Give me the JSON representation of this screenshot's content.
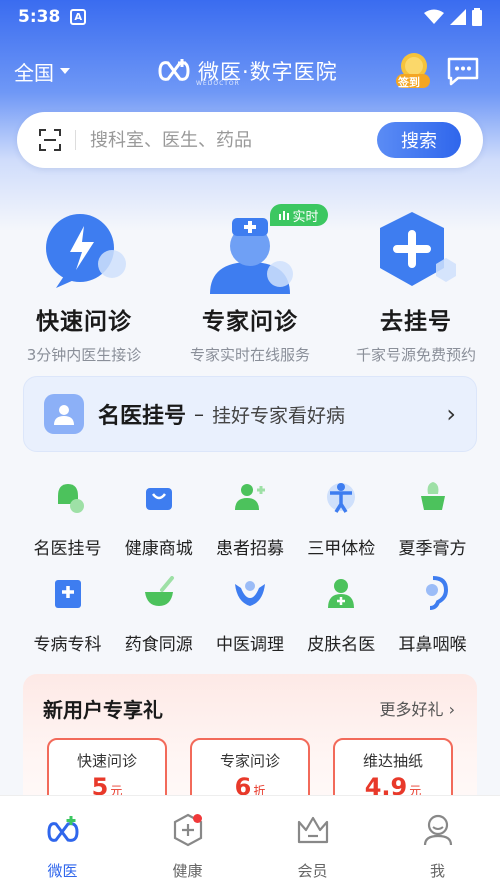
{
  "status": {
    "time": "5:38",
    "a_icon": "A"
  },
  "header": {
    "region": "全国",
    "brand_name": "微医·数字医院",
    "brand_sub": "WEDOCTOR",
    "checkin": "签到"
  },
  "search": {
    "placeholder": "搜科室、医生、药品",
    "button": "搜索"
  },
  "big_cards": [
    {
      "title": "快速问诊",
      "sub": "3分钟内医生接诊",
      "icon": "lightning-bubble-icon"
    },
    {
      "title": "专家问诊",
      "sub": "专家实时在线服务",
      "icon": "doctor-avatar-icon",
      "badge": "实时"
    },
    {
      "title": "去挂号",
      "sub": "千家号源免费预约",
      "icon": "hexagon-plus-icon"
    }
  ],
  "banner": {
    "title": "名医挂号",
    "dash": "–",
    "sub": "挂好专家看好病"
  },
  "grid": [
    [
      {
        "label": "名医挂号",
        "icon": "bell-icon",
        "color": "#4cc25c"
      },
      {
        "label": "健康商城",
        "icon": "shopping-bag-icon",
        "color": "#3e7df0"
      },
      {
        "label": "患者招募",
        "icon": "person-add-icon",
        "color": "#4cc25c"
      },
      {
        "label": "三甲体检",
        "icon": "body-check-icon",
        "color": "#3e7df0"
      },
      {
        "label": "夏季膏方",
        "icon": "herb-pot-icon",
        "color": "#4cc25c"
      }
    ],
    [
      {
        "label": "专病专科",
        "icon": "hospital-icon",
        "color": "#3e7df0"
      },
      {
        "label": "药食同源",
        "icon": "mortar-icon",
        "color": "#4cc25c"
      },
      {
        "label": "中医调理",
        "icon": "hands-icon",
        "color": "#3e7df0"
      },
      {
        "label": "皮肤名医",
        "icon": "skin-doctor-icon",
        "color": "#4cc25c"
      },
      {
        "label": "耳鼻咽喉",
        "icon": "ear-icon",
        "color": "#3e7df0"
      }
    ]
  ],
  "promo": {
    "title": "新用户专享礼",
    "more": "更多好礼 ›",
    "coupons": [
      {
        "name": "快速问诊",
        "value": "5",
        "unit": "元"
      },
      {
        "name": "专家问诊",
        "value": "6",
        "unit": "折"
      },
      {
        "name": "维达抽纸",
        "value": "4.9",
        "unit": "元"
      }
    ]
  },
  "tabbar": [
    {
      "label": "微医",
      "icon": "wedoctor-logo-icon",
      "active": true
    },
    {
      "label": "健康",
      "icon": "health-hexagon-icon"
    },
    {
      "label": "会员",
      "icon": "crown-icon"
    },
    {
      "label": "我",
      "icon": "user-icon"
    }
  ],
  "colors": {
    "primary": "#2f66ec",
    "green": "#3cc761",
    "red": "#e8392a"
  }
}
